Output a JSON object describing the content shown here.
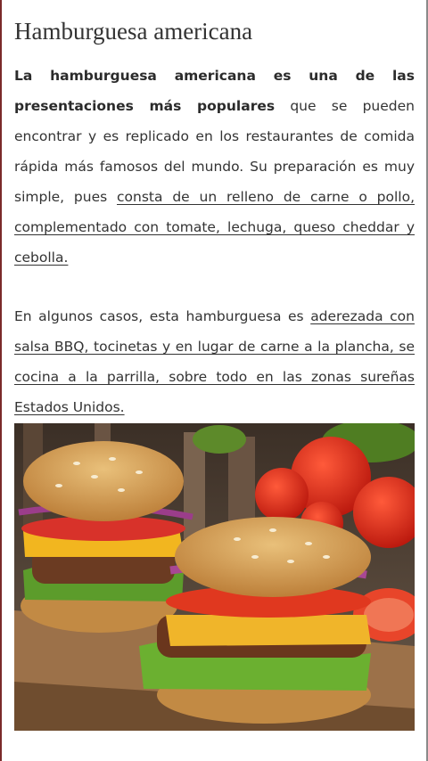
{
  "article": {
    "title": "Hamburguesa americana",
    "paragraph1": {
      "bold": "La hamburguesa americana es una de las presentaciones más populares",
      "text": " que se pueden encontrar y es replicado en los restaurantes de comida rápida más famosos del mundo. Su preparación es muy simple, pues ",
      "link": "consta de un relleno de carne o pollo, complementado con tomate, lechuga, queso cheddar y cebolla."
    },
    "paragraph2": {
      "text": "En algunos casos, esta hamburguesa es ",
      "link": "aderezada con salsa BBQ, tocinetas y en lugar de carne a la plancha, se cocina a la parrilla, sobre todo en las zonas sureñas Estados Unidos."
    }
  },
  "colors": {
    "text": "#333333",
    "left_border": "#7a2a2a"
  }
}
